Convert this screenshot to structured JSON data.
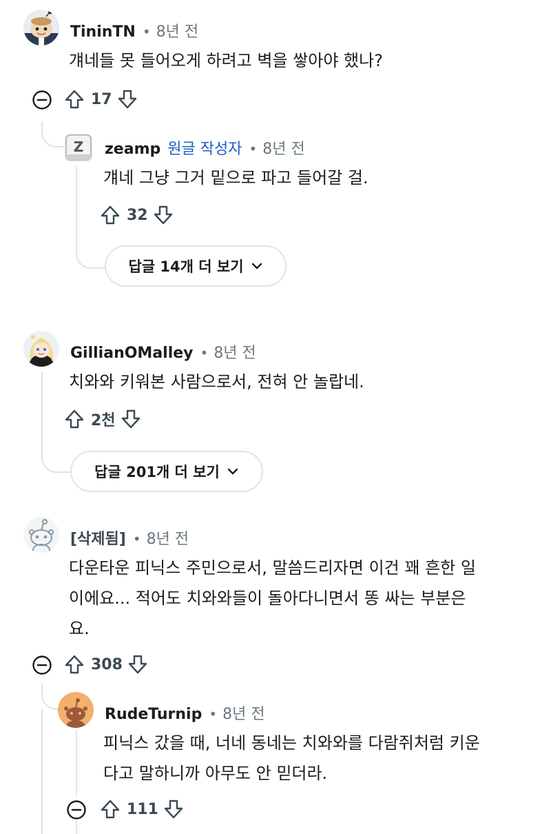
{
  "comments": [
    {
      "author": "TininTN",
      "time": "8년 전",
      "text_lines": [
        "걔네들 못 들어오게 하려고 벽을 쌓아야 했나?"
      ],
      "score": "17"
    },
    {
      "author": "zeamp",
      "op_label": "원글 작성자",
      "time": "8년 전",
      "text_lines": [
        "걔네 그냥 그거 밑으로 파고 들어갈 걸."
      ],
      "score": "32",
      "more_replies": "답글 14개 더 보기"
    },
    {
      "author": "GillianOMalley",
      "time": "8년 전",
      "text_lines": [
        "치와와 키워본 사람으로서, 전혀 안 놀랍네."
      ],
      "score": "2천",
      "more_replies": "답글 201개 더 보기"
    },
    {
      "author": "[삭제됨]",
      "time": "8년 전",
      "text_lines": [
        "다운타운 피닉스 주민으로서, 말씀드리자면 이건 꽤 흔한 일",
        "이에요... 적어도 치와와들이 돌아다니면서 똥 싸는 부분은",
        "요."
      ],
      "score": "308"
    },
    {
      "author": "RudeTurnip",
      "time": "8년 전",
      "text_lines": [
        "피닉스 갔을 때, 너네 동네는 치와와를 다람쥐처럼 키운",
        "다고 말하니까 아무도 안 믿더라."
      ],
      "score": "111"
    }
  ],
  "icons": {
    "upvote": "arrow-up-outline",
    "downvote": "arrow-down-outline",
    "collapse": "circle-minus",
    "expand": "chevron-down"
  },
  "colors": {
    "op_label": "#1f5cc7",
    "meta_gray": "#6a7880",
    "thread_line": "#e0e4e7",
    "zeamp_avatar_bg": "#e6e6e6",
    "rudeturnip_avatar_bg": "#f3b06d"
  }
}
